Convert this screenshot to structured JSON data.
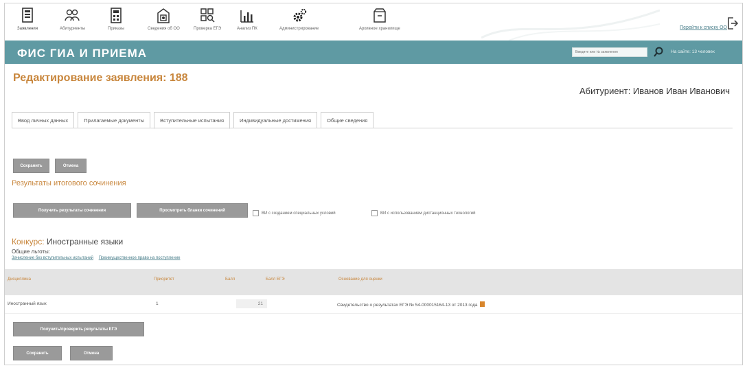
{
  "nav": {
    "items": [
      {
        "label": "Заявления",
        "icon": "document-list-icon"
      },
      {
        "label": "Абитуриенты",
        "icon": "people-icon"
      },
      {
        "label": "Приказы",
        "icon": "calculator-icon"
      },
      {
        "label": "Сведения об ОО",
        "icon": "building-doc-icon"
      },
      {
        "label": "Проверка ЕГЭ",
        "icon": "grid-search-icon"
      },
      {
        "label": "Анализ ПК",
        "icon": "bar-chart-icon"
      },
      {
        "label": "Администрирование",
        "icon": "gears-icon"
      },
      {
        "label": "Архивное хранилище",
        "icon": "archive-icon"
      }
    ],
    "switch_link": "Перейти к списку ОО"
  },
  "banner": {
    "brand": "ФИС ГИА И ПРИЕМА",
    "search_placeholder": "Введите или № заявления",
    "site_info": "На сайте: 13 человек"
  },
  "page": {
    "title": "Редактирование заявления: 188",
    "applicant": "Абитуриент: Иванов Иван Иванович"
  },
  "tabs": [
    "Ввод личных данных",
    "Прилагаемые документы",
    "Вступительные испытания",
    "Индивидуальные достижения",
    "Общие сведения"
  ],
  "buttons": {
    "save": "Сохранить",
    "cancel": "Отмена",
    "get_essay_results": "Получить результаты сочинения",
    "view_essay_forms": "Просмотреть бланки сочинений",
    "get_check_ege": "Получить/проверить результаты ЕГЭ"
  },
  "essay": {
    "title": "Результаты итогового сочинения",
    "checkbox_special": "ВИ с созданием специальных условий",
    "checkbox_remote": "ВИ с использованием дистанционных технологий"
  },
  "contest": {
    "prefix": "Конкурс:",
    "name": "Иностранные языки",
    "common_privileges": "Общие льготы:",
    "links": [
      "Зачисление без вступительных испытаний",
      "Преимущественное право на поступление"
    ]
  },
  "table": {
    "headers": [
      "Дисциплина",
      "Приоритет",
      "Балл",
      "Балл ЕГЭ",
      "Основание для оценки"
    ],
    "rows": [
      {
        "discipline": "Иностранный язык",
        "priority": "1",
        "score": "",
        "ege_score": "21",
        "basis": "Свидетельство о результатах ЕГЭ № 54-000015164-13 от 2013 года"
      }
    ]
  },
  "colors": {
    "banner": "#5f9aa3",
    "accent": "#c8863c",
    "button": "#9a9a9a"
  }
}
